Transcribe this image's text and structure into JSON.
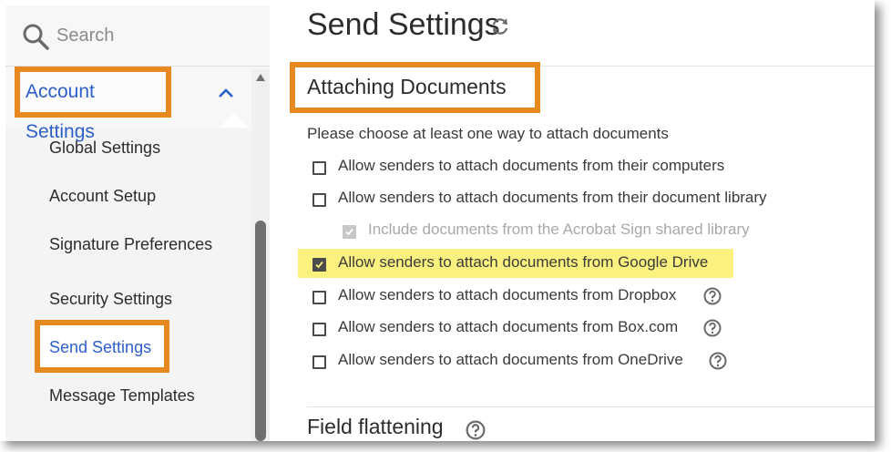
{
  "sidebar": {
    "search_placeholder": "Search",
    "section_label": "Account Settings",
    "items": [
      {
        "label": "Global Settings"
      },
      {
        "label": "Account Setup"
      },
      {
        "label": "Signature Preferences"
      },
      {
        "label": "Security Settings"
      },
      {
        "label": "Send Settings"
      },
      {
        "label": "Message Templates"
      }
    ]
  },
  "main": {
    "title": "Send Settings",
    "section_title": "Attaching Documents",
    "instruction": "Please choose at least one way to attach documents",
    "options": [
      {
        "label": "Allow senders to attach documents from their computers",
        "checked": false
      },
      {
        "label": "Allow senders to attach documents from their document library",
        "checked": false
      },
      {
        "label": "Include documents from the Acrobat Sign shared library",
        "checked": true,
        "disabled": true
      },
      {
        "label": "Allow senders to attach documents from Google Drive",
        "checked": true
      },
      {
        "label": "Allow senders to attach documents from Dropbox",
        "checked": false
      },
      {
        "label": "Allow senders to attach documents from Box.com",
        "checked": false
      },
      {
        "label": "Allow senders to attach documents from OneDrive",
        "checked": false
      }
    ],
    "next_section_title": "Field flattening"
  },
  "icons": {
    "search": "search-icon",
    "chevron": "chevron-up-icon",
    "refresh": "refresh-icon",
    "help": "help-icon"
  },
  "colors": {
    "accent_blue": "#2c5fc9",
    "annotation_orange": "#e8891f",
    "highlight_yellow": "#fbf17f"
  }
}
